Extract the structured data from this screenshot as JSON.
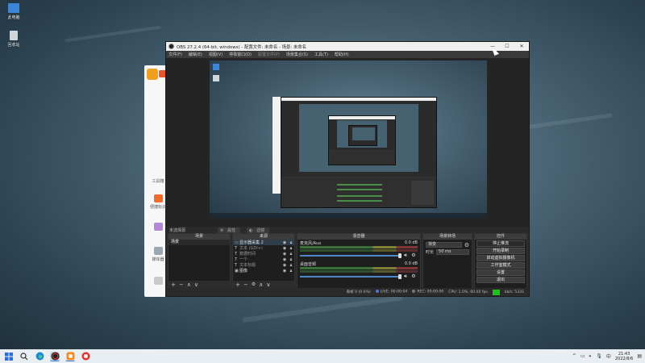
{
  "desktop": {
    "icons": [
      {
        "label": "此电脑",
        "icon": "this-pc-icon"
      },
      {
        "label": "回收站",
        "icon": "recycle-bin-icon"
      }
    ]
  },
  "background_app": {
    "sidebar": [
      {
        "label": "工具箱",
        "icon": "toolbox-icon"
      },
      {
        "label": "便捷标识",
        "icon": "shortcut-icon"
      },
      {
        "label": "",
        "icon": "photo-icon"
      },
      {
        "label": "媒体器",
        "icon": "media-icon"
      },
      {
        "label": "",
        "icon": "chat-icon"
      }
    ]
  },
  "obs": {
    "title": "OBS 27.2.4 (64-bit, windows) - 配置文件: 未命名 - 场景: 未命名",
    "window_controls": {
      "minimize": "—",
      "maximize": "☐",
      "close": "✕"
    },
    "menu": [
      "文件(F)",
      "编辑(E)",
      "视图(V)",
      "停靠窗口(D)",
      "配置文件(P)",
      "场景集合(S)",
      "工具(T)",
      "帮助(H)"
    ],
    "menu_disabled_index": 4,
    "source_bar": {
      "label": "未选择源",
      "props_button": "属性",
      "filters_button": "滤镜"
    },
    "docks": {
      "scenes": {
        "title": "场景",
        "items": [
          "场景"
        ]
      },
      "sources": {
        "title": "来源",
        "items": [
          {
            "name": "显示器采集 2",
            "type": "monitor"
          },
          {
            "name": "文本 (GDI+)",
            "type": "text"
          },
          {
            "name": "数据时间",
            "type": "text"
          },
          {
            "name": "一个",
            "type": "text"
          },
          {
            "name": "文本标题",
            "type": "text"
          },
          {
            "name": "图像",
            "type": "image"
          }
        ]
      },
      "mixer": {
        "title": "混音器",
        "channels": [
          {
            "name": "麦克风/Aux",
            "db": "0.0 dB"
          },
          {
            "name": "桌面音频",
            "db": "0.0 dB"
          }
        ]
      },
      "transitions": {
        "title": "场景转场",
        "type_value": "渐变",
        "duration_label": "时长",
        "duration_value": "50 ms"
      },
      "controls": {
        "title": "控件",
        "buttons": [
          "停止推流",
          "开始录制",
          "启动虚拟摄像机",
          "工作室模式",
          "设置",
          "退出"
        ]
      }
    },
    "status": {
      "dropped": "丢帧 0 (0.0%)",
      "live": "LIVE: 00:00:04",
      "rec": "REC: 00:00:00",
      "cpu": "CPU: 1.0%, 60.00 fps",
      "kbps": "kb/s: 5331"
    }
  },
  "taskbar": {
    "apps": [
      "start-icon",
      "search-icon",
      "edge-icon",
      "obs-icon",
      "app-orange-icon",
      "app-red-icon"
    ],
    "tray": {
      "chevron": "^",
      "ime": "中",
      "time": "21:43",
      "date": "2022/8/6"
    }
  }
}
